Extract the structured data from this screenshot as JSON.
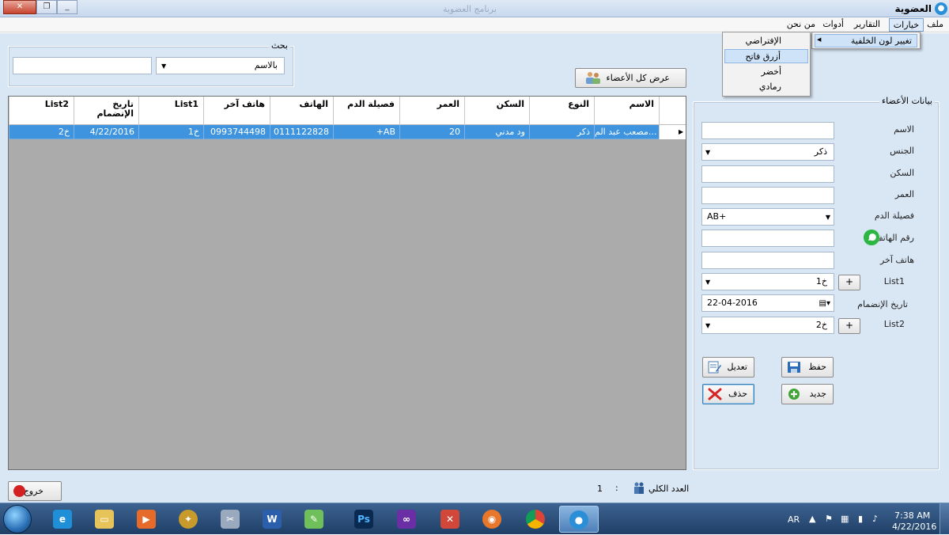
{
  "window": {
    "title": "العضوية",
    "faded_title": "برنامج العضوية"
  },
  "menu": {
    "file": "ملف",
    "options": "خيارات",
    "reports": "التقارير",
    "tools": "أدوات",
    "about": "من نحن"
  },
  "options_menu": {
    "change_bg": "تغيير لون الخلفية"
  },
  "bg_submenu": [
    "الإفتراضي",
    "أزرق فاتح",
    "أخضر",
    "رمادي"
  ],
  "search": {
    "title": "بحث",
    "by": "بالاسم",
    "value": ""
  },
  "show_all_label": "عرض كل الأعضاء",
  "grid": {
    "columns": [
      "الاسم",
      "النوع",
      "السكن",
      "العمر",
      "فصيلة الدم",
      "الهاتف",
      "هاتف آخر",
      "List1",
      "تاريخ\nالإنضمام",
      "List2"
    ],
    "rows": [
      [
        "مصعب عبد الم...",
        "ذكر",
        "ود مدني",
        "20",
        "+AB",
        "0111122828",
        "0993744498",
        "خ1",
        "4/22/2016",
        "خ2"
      ]
    ]
  },
  "panel": {
    "title": "بيانات الأعضاء",
    "labels": {
      "name": "الاسم",
      "gender": "الجنس",
      "residence": "السكن",
      "age": "العمر",
      "blood": "فصيلة الدم",
      "phone": "رقم الهاتف",
      "phone2": "هاتف آخر",
      "list1": "List1",
      "join_date": "تاريخ الإنضمام",
      "list2": "List2"
    },
    "values": {
      "name": "",
      "gender": "ذكر",
      "residence": "",
      "age": "",
      "blood": "AB+",
      "phone": "",
      "phone2": "",
      "list1": "خ1",
      "join_date": "22-04-2016",
      "list2": "خ2"
    },
    "buttons": {
      "edit": "تعديل",
      "save": "حفظ",
      "delete": "حذف",
      "new": "جديد",
      "plus": "+"
    }
  },
  "footer": {
    "exit": "خروج",
    "total_label": "العدد الكلي",
    "total_sep": ":",
    "total_value": "1"
  },
  "taskbar": {
    "apps": [
      "ie",
      "explorer",
      "media",
      "app-gold",
      "tools",
      "word",
      "notepad",
      "photoshop",
      "visual-studio",
      "xmind",
      "firefox",
      "chrome",
      "membership"
    ],
    "lang": "AR",
    "time": "7:38 AM",
    "date": "4/22/2016"
  },
  "colors": {
    "panel_bg": "#d9e6f4",
    "selection": "#3f94df",
    "taskbar": "#2a4d7a"
  }
}
